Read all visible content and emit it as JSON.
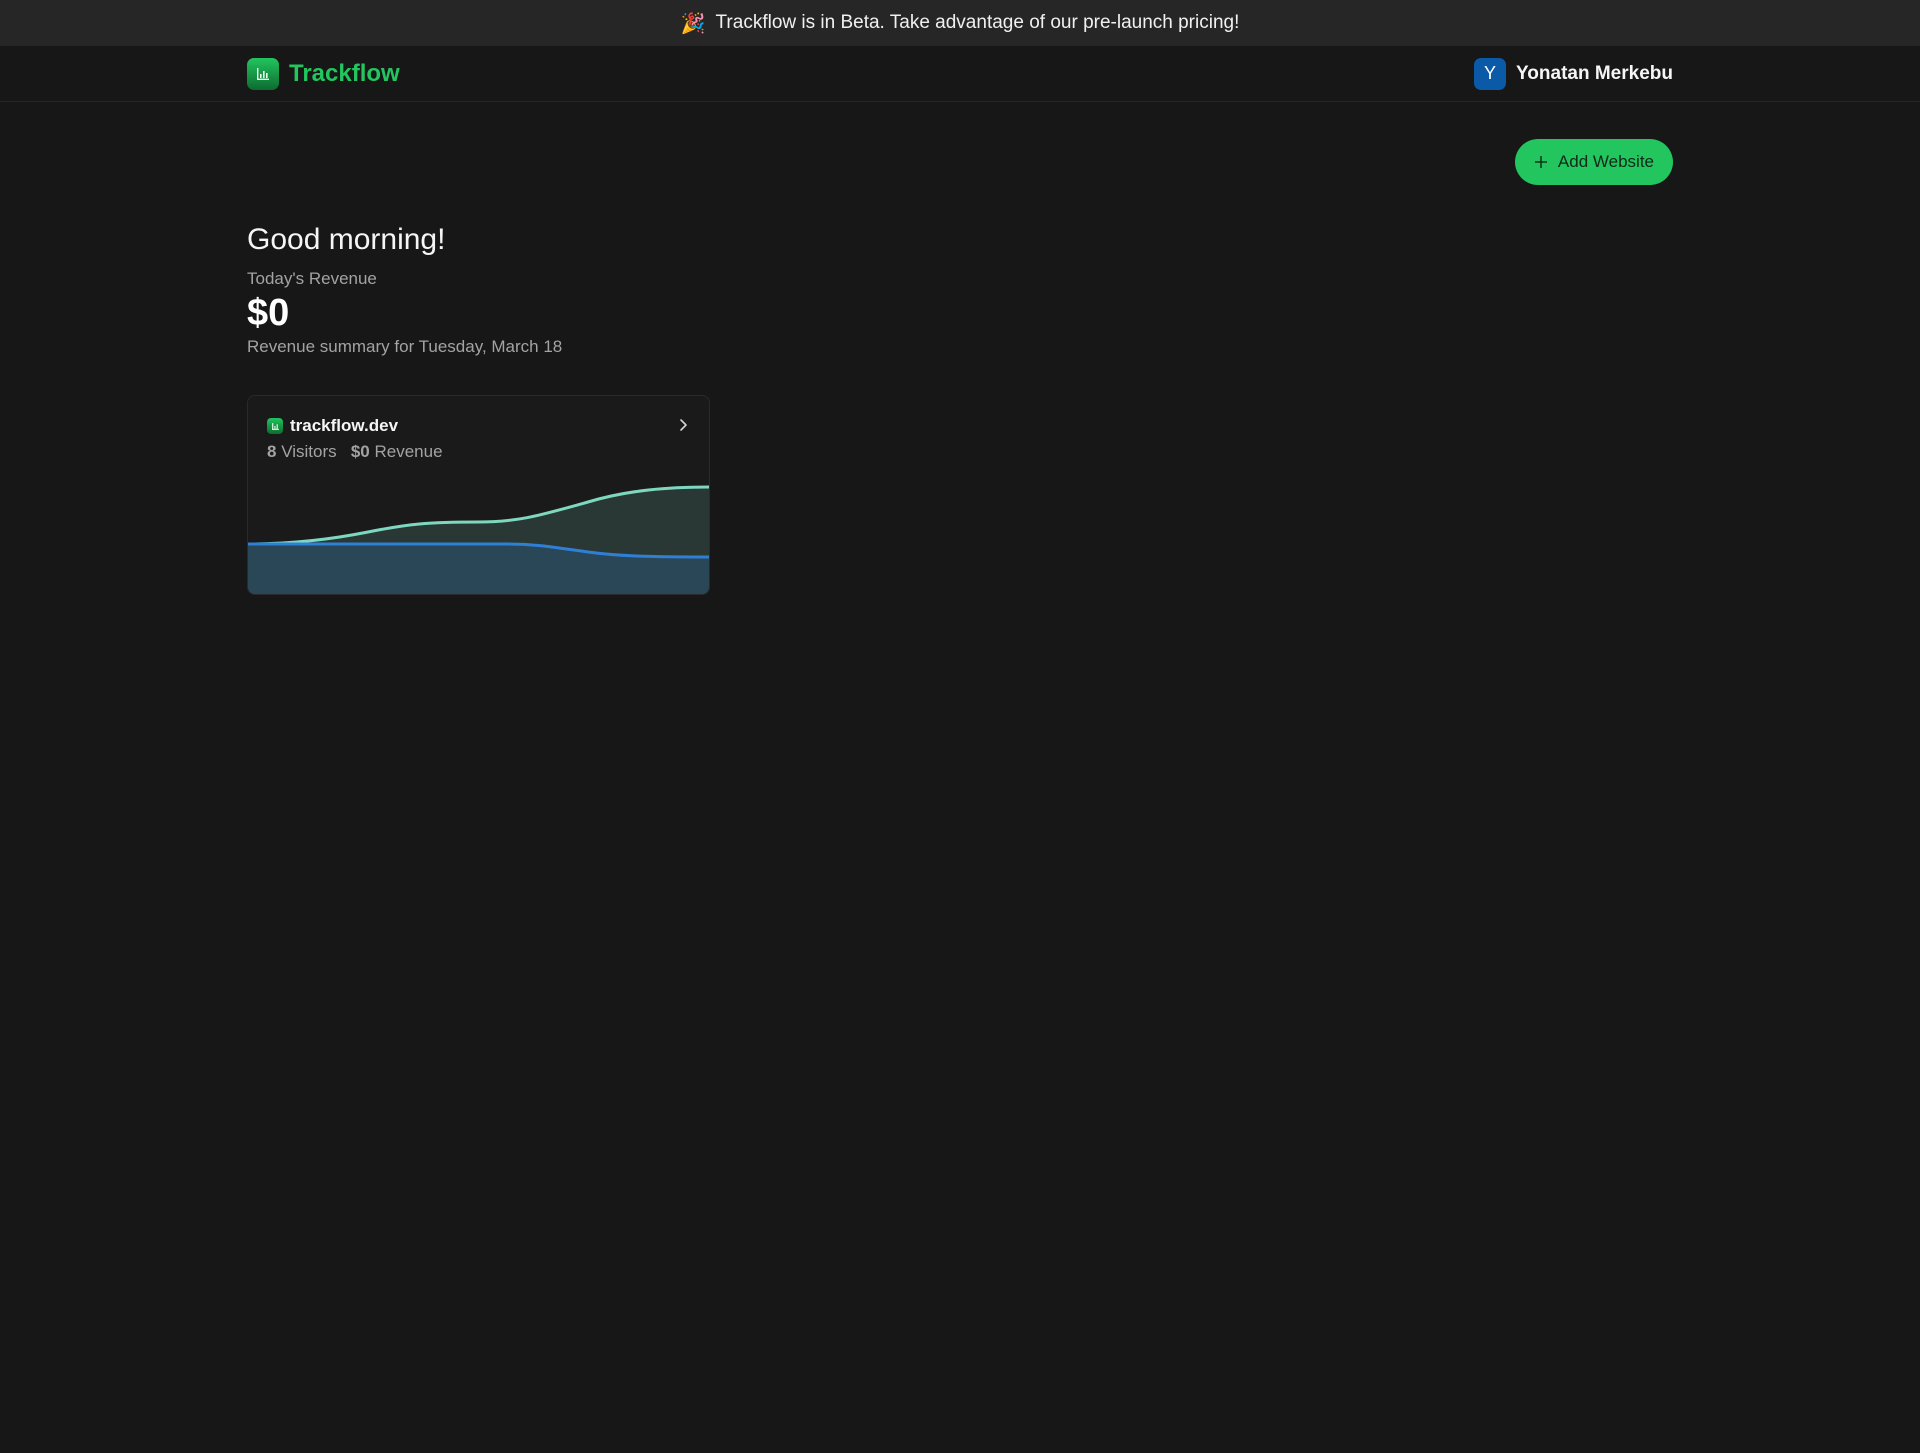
{
  "banner": {
    "emoji": "🎉",
    "text": "Trackflow is in Beta. Take advantage of our pre-launch pricing!"
  },
  "nav": {
    "brand": "Trackflow",
    "user": {
      "initial": "Y",
      "name": "Yonatan Merkebu"
    }
  },
  "actions": {
    "add_website": "Add Website"
  },
  "dashboard": {
    "greeting": "Good morning!",
    "revenue_label": "Today's Revenue",
    "revenue_value": "$0",
    "summary": "Revenue summary for Tuesday, March 18"
  },
  "sites": [
    {
      "domain": "trackflow.dev",
      "visitors": "8",
      "visitors_label": "Visitors",
      "revenue": "$0",
      "revenue_label": "Revenue"
    }
  ],
  "colors": {
    "accent": "#22c55e",
    "visitors_line": "#7dd8bf",
    "revenue_line": "#2f7fd6",
    "avatar": "#0b5aa8"
  },
  "icons": {
    "brand": "bar-chart-icon",
    "add": "plus-icon",
    "open": "chevron-right-icon"
  }
}
